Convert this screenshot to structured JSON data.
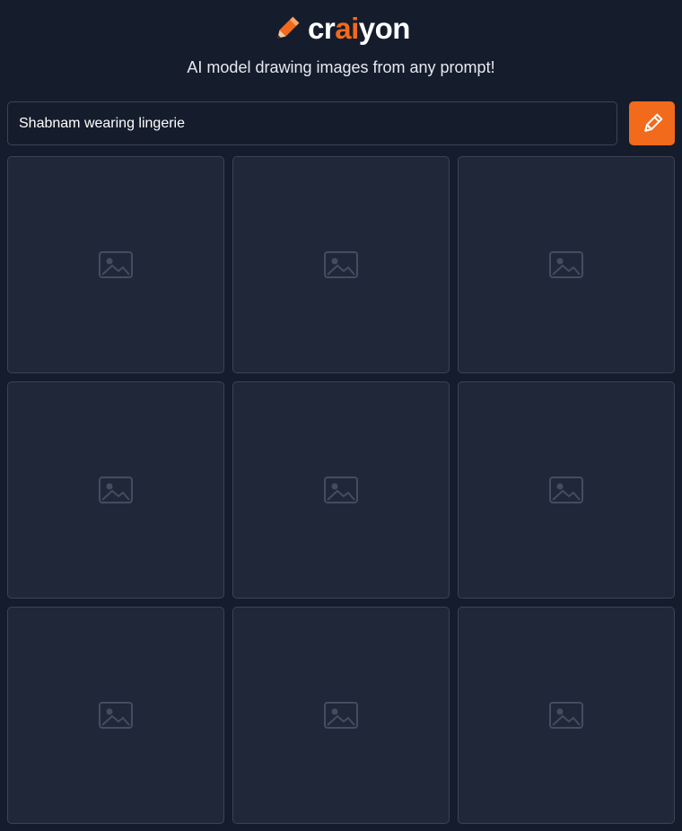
{
  "header": {
    "logo_prefix": "cr",
    "logo_ai": "ai",
    "logo_suffix": "yon",
    "tagline": "AI model drawing images from any prompt!"
  },
  "prompt": {
    "value": "Shabnam wearing lingerie"
  },
  "results": {
    "count": 9
  },
  "colors": {
    "background": "#151c2c",
    "accent": "#f26a1b",
    "border": "#3b4356"
  },
  "icons": {
    "logo": "pencil-icon",
    "draw_button": "pencil-icon",
    "tile": "image-placeholder-icon"
  }
}
